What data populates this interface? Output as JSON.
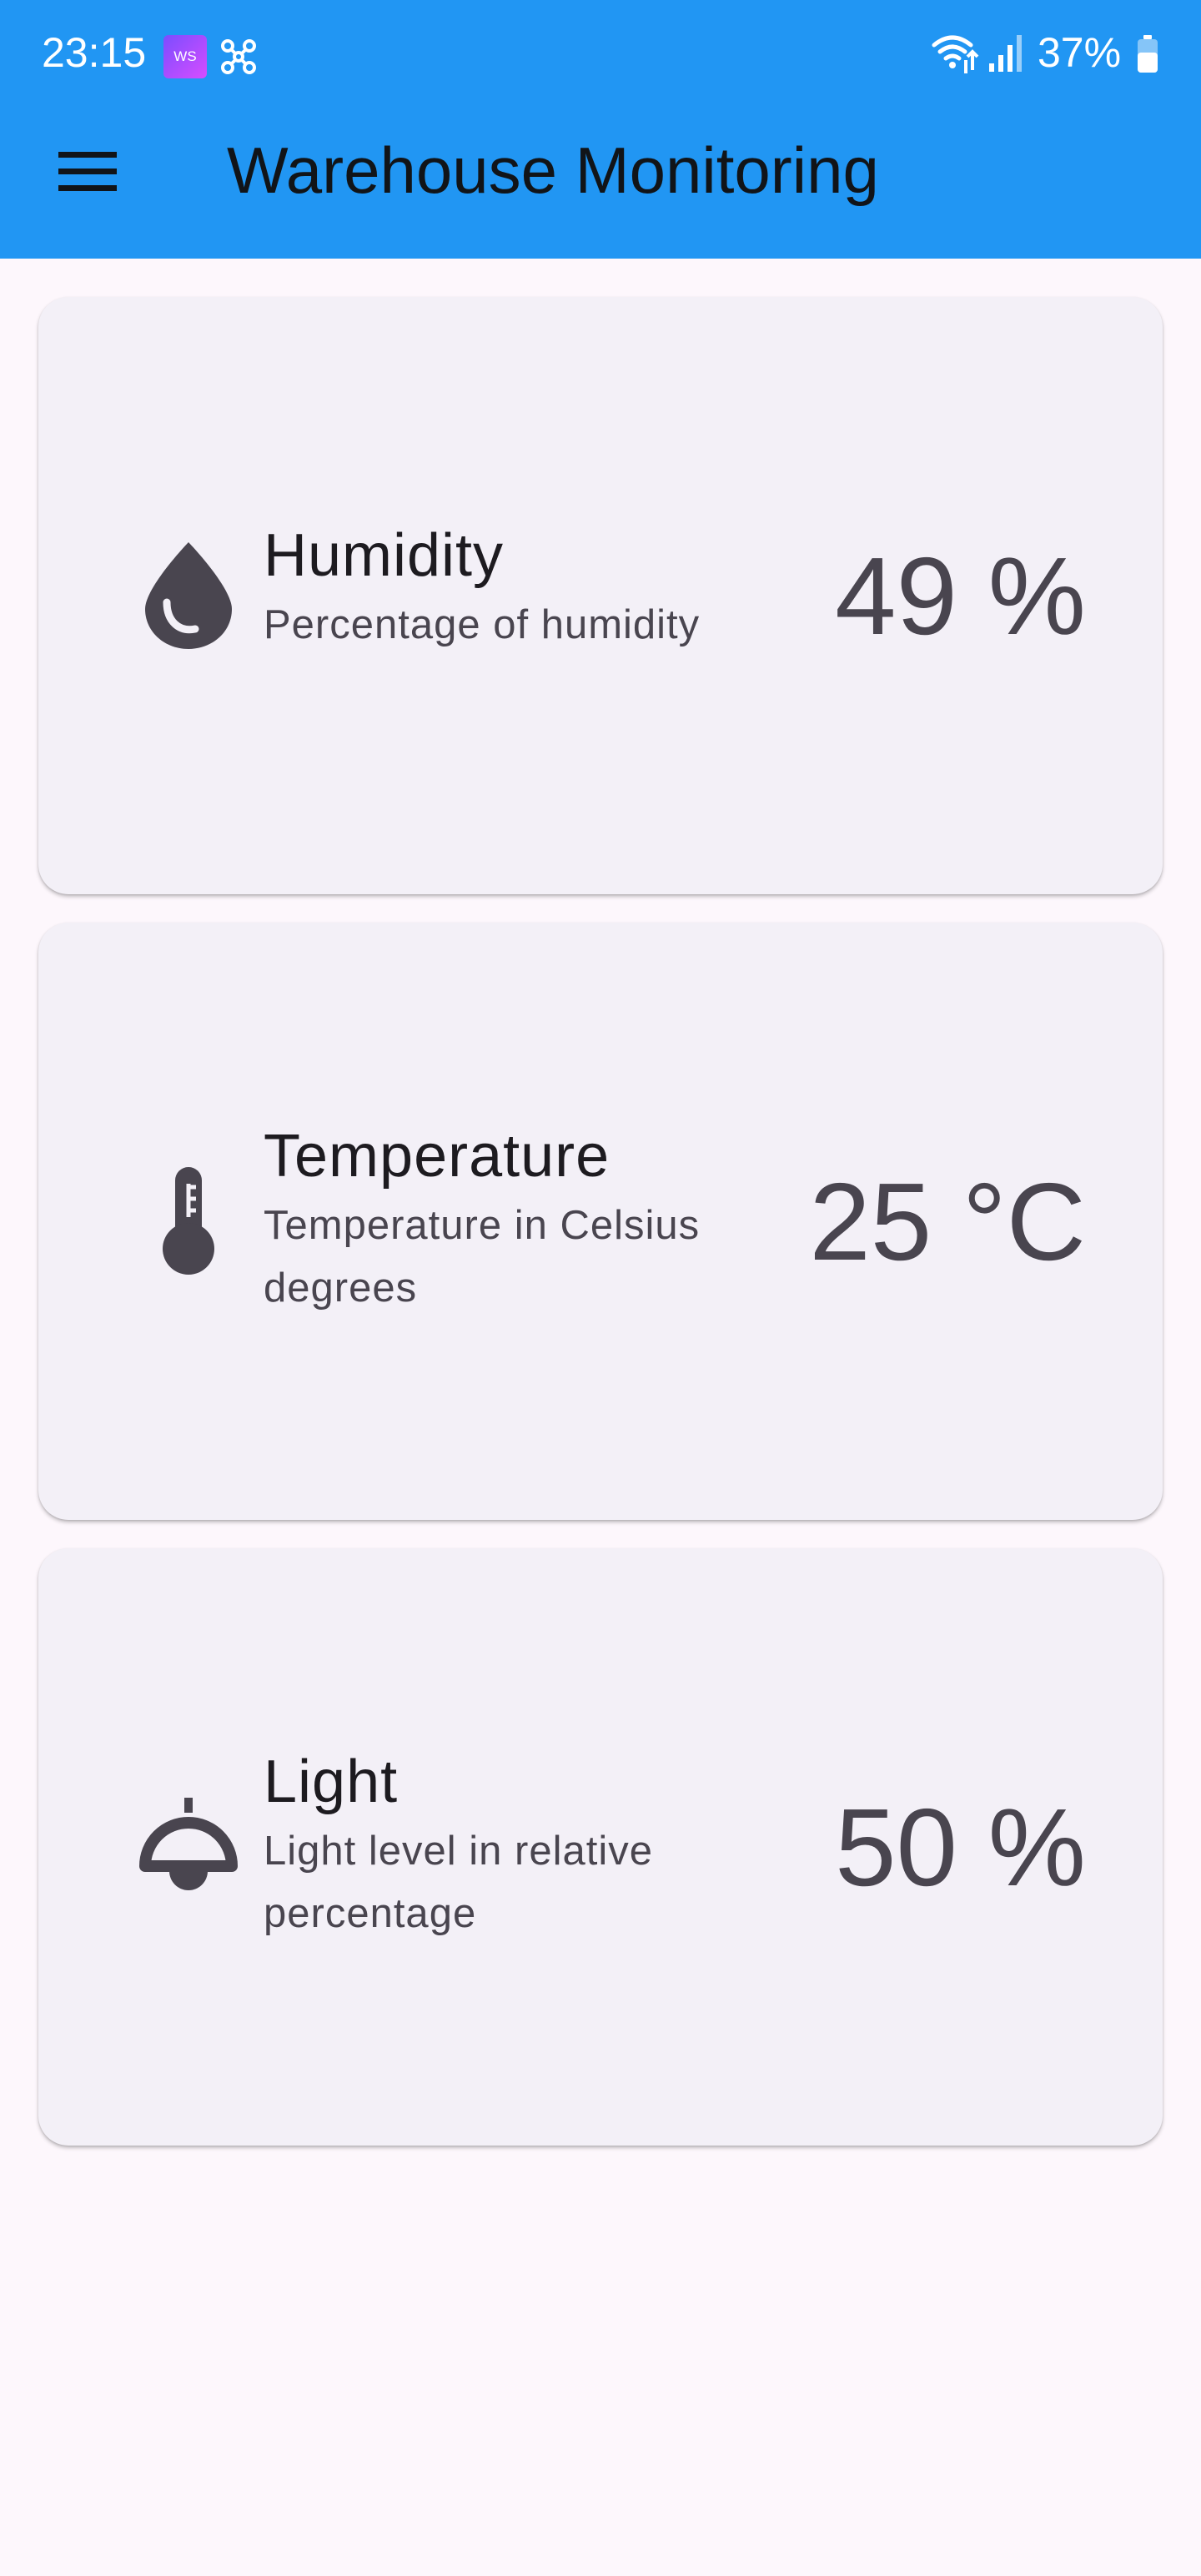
{
  "status_bar": {
    "time": "23:15",
    "app_badge": "WS",
    "battery_percent": "37%"
  },
  "app_bar": {
    "title": "Warehouse Monitoring",
    "background_color": "#2196f3"
  },
  "sensors": [
    {
      "title": "Humidity",
      "subtitle": "Percentage of humidity",
      "value": "49 %",
      "icon": "water-drop-icon"
    },
    {
      "title": "Temperature",
      "subtitle": "Temperature in Celsius degrees",
      "value": "25 °C",
      "icon": "thermometer-icon"
    },
    {
      "title": "Light",
      "subtitle": "Light level in relative percentage",
      "value": "50 %",
      "icon": "lamp-icon"
    }
  ]
}
